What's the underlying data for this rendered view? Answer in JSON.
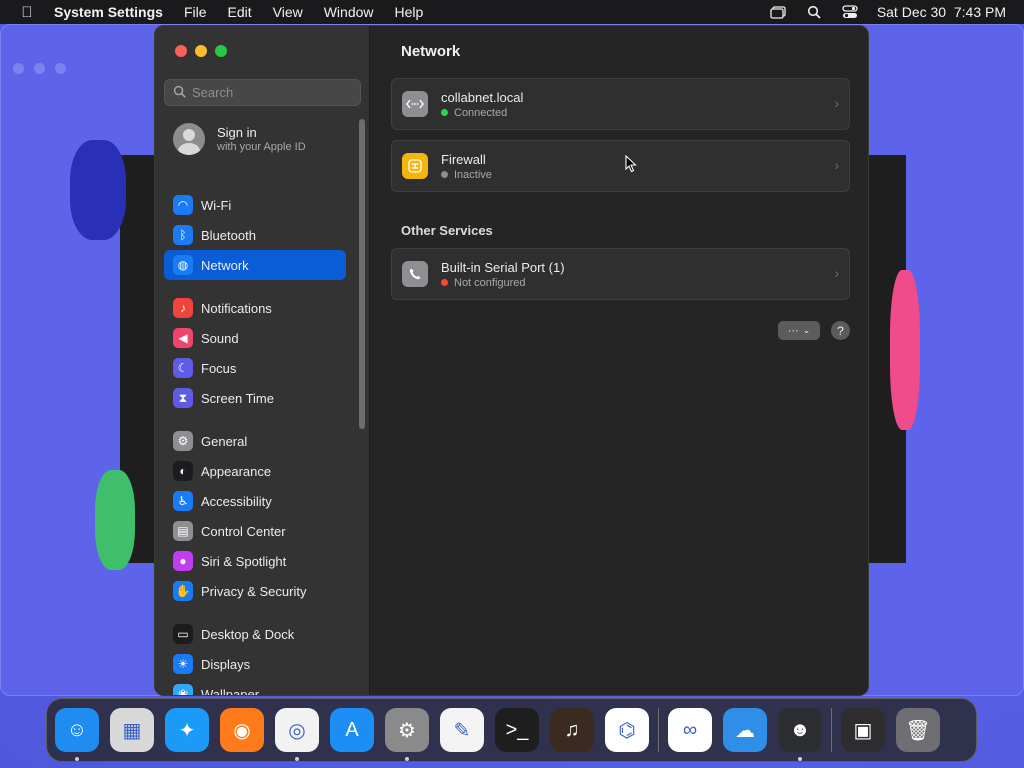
{
  "menubar": {
    "app_name": "System Settings",
    "menus": [
      "File",
      "Edit",
      "View",
      "Window",
      "Help"
    ],
    "datetime": "Sat Dec 30  7:43 PM"
  },
  "sidebar": {
    "search_placeholder": "Search",
    "signin": {
      "title": "Sign in",
      "subtitle": "with your Apple ID"
    },
    "items": [
      {
        "label": "Wi-Fi",
        "icon": "wifi-icon",
        "color": "#1a7cf5"
      },
      {
        "label": "Bluetooth",
        "icon": "bluetooth-icon",
        "color": "#1a7cf5"
      },
      {
        "label": "Network",
        "icon": "globe-icon",
        "color": "#1a7cf5",
        "active": true
      },
      {
        "label": "Notifications",
        "icon": "bell-icon",
        "color": "#f1443b"
      },
      {
        "label": "Sound",
        "icon": "speaker-icon",
        "color": "#f0446a"
      },
      {
        "label": "Focus",
        "icon": "moon-icon",
        "color": "#5e5ce6"
      },
      {
        "label": "Screen Time",
        "icon": "hourglass-icon",
        "color": "#5e5ce6"
      },
      {
        "label": "General",
        "icon": "gear-icon",
        "color": "#8e8e93"
      },
      {
        "label": "Appearance",
        "icon": "appearance-icon",
        "color": "#1c1c1e"
      },
      {
        "label": "Accessibility",
        "icon": "accessibility-icon",
        "color": "#1a7cf5"
      },
      {
        "label": "Control Center",
        "icon": "control-center-icon",
        "color": "#8e8e93"
      },
      {
        "label": "Siri & Spotlight",
        "icon": "siri-icon",
        "color": "#c23cf0"
      },
      {
        "label": "Privacy & Security",
        "icon": "hand-icon",
        "color": "#1a7cf5"
      },
      {
        "label": "Desktop & Dock",
        "icon": "dock-icon",
        "color": "#1c1c1e"
      },
      {
        "label": "Displays",
        "icon": "sun-icon",
        "color": "#1a7cf5"
      },
      {
        "label": "Wallpaper",
        "icon": "wallpaper-icon",
        "color": "#33a7f5"
      }
    ]
  },
  "main": {
    "title": "Network",
    "services": [
      {
        "name": "collabnet.local",
        "status": "Connected",
        "status_color": "#30d158",
        "icon": "vpn-icon",
        "icon_color": "#8e8e93"
      },
      {
        "name": "Firewall",
        "status": "Inactive",
        "status_color": "#8e8e93",
        "icon": "firewall-icon",
        "icon_color": "#f5b50a"
      }
    ],
    "other_title": "Other Services",
    "other_services": [
      {
        "name": "Built-in Serial Port (1)",
        "status": "Not configured",
        "status_color": "#ff453a",
        "icon": "phone-icon",
        "icon_color": "#8e8e93"
      }
    ],
    "more_label": "···",
    "help_label": "?"
  },
  "dock": {
    "apps": [
      {
        "name": "finder-icon",
        "color": "#1e8cf0",
        "running": true
      },
      {
        "name": "launchpad-icon",
        "color": "#d8d8d8",
        "running": false
      },
      {
        "name": "safari-icon",
        "color": "#1b9af7",
        "running": false
      },
      {
        "name": "firefox-icon",
        "color": "#ff7a1a",
        "running": false
      },
      {
        "name": "chrome-icon",
        "color": "#f2f2f2",
        "running": true
      },
      {
        "name": "app-store-icon",
        "color": "#1c8ef6",
        "running": false
      },
      {
        "name": "system-settings-icon",
        "color": "#8a8a8a",
        "running": true
      },
      {
        "name": "textedit-icon",
        "color": "#f4f4f4",
        "running": false
      },
      {
        "name": "terminal-icon",
        "color": "#1e1e1e",
        "running": false
      },
      {
        "name": "garageband-icon",
        "color": "#3a2a20",
        "running": false
      },
      {
        "name": "vscode-icon",
        "color": "#ffffff",
        "running": false
      },
      {
        "name": "visual-studio-icon",
        "color": "#ffffff",
        "running": false
      },
      {
        "name": "weather-icon",
        "color": "#2e8ee8",
        "running": false
      },
      {
        "name": "discord-icon",
        "color": "#2b2d31",
        "running": true
      }
    ],
    "extras": [
      {
        "name": "downloads-stack-icon",
        "color": "#2d2d30"
      },
      {
        "name": "trash-icon",
        "color": "#6e6e73"
      }
    ]
  }
}
